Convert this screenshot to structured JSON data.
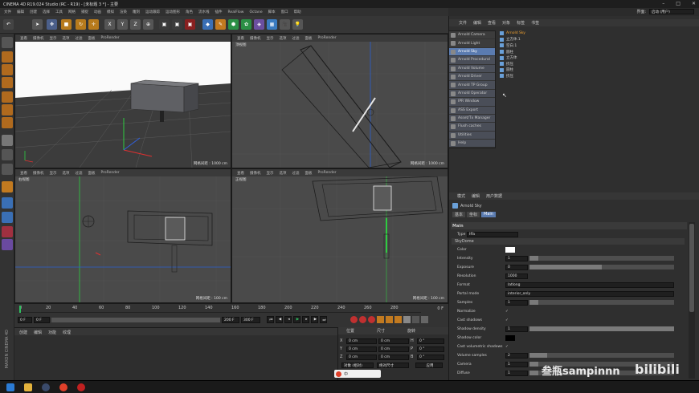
{
  "window": {
    "title": "CINEMA 4D R19.024 Studio (RC - R19) - [未标题 3 *] - 主要"
  },
  "menubar": [
    "文件",
    "编辑",
    "创建",
    "选择",
    "工具",
    "网格",
    "捕捉",
    "动画",
    "模拟",
    "渲染",
    "雕刻",
    "运动跟踪",
    "运动图形",
    "角色",
    "流水线",
    "插件",
    "RealFlow",
    "Octane",
    "脚本",
    "窗口",
    "帮助"
  ],
  "toolbar": {
    "x": "X",
    "y": "Y",
    "z": "Z"
  },
  "viewports": {
    "menu": [
      "查看",
      "摄像机",
      "显示",
      "选项",
      "过滤",
      "面板",
      "ProRender"
    ],
    "v1": {
      "label": "",
      "foot": "网格间距 : 1000 cm"
    },
    "v2": {
      "label": "顶视图",
      "foot": "网格间距 : 1000 cm"
    },
    "v3": {
      "label": "右视图",
      "foot": "网格间距 : 100 cm"
    },
    "v4": {
      "label": "正视图",
      "foot": "网格间距 : 100 cm"
    }
  },
  "timeline": {
    "ticks": [
      "0",
      "20",
      "40",
      "60",
      "80",
      "100",
      "120",
      "140",
      "160",
      "180",
      "200",
      "220",
      "240",
      "260",
      "280"
    ],
    "frame_start": "0 F",
    "frame_cur": "0 F",
    "frame_end": "200 F",
    "frame_end2": "300 F",
    "frame_label": "0 F"
  },
  "matpanel": {
    "menu": [
      "创建",
      "编辑",
      "功能",
      "纹理"
    ]
  },
  "coords": {
    "headers": [
      "位置",
      "尺寸",
      "旋转"
    ],
    "rows": [
      {
        "axis": "X",
        "pos": "0 cm",
        "size": "0 cm",
        "rot_axis": "H",
        "rot": "0 °"
      },
      {
        "axis": "Y",
        "pos": "0 cm",
        "size": "0 cm",
        "rot_axis": "P",
        "rot": "0 °"
      },
      {
        "axis": "Z",
        "pos": "0 cm",
        "size": "0 cm",
        "rot_axis": "B",
        "rot": "0 °"
      }
    ],
    "mode": "对象 (相对)",
    "size_mode": "绝对尺寸",
    "apply": "应用"
  },
  "right": {
    "layout_label": "界面:",
    "layout_value": "启动 (用户)",
    "obj_tabs": [
      "文件",
      "编辑",
      "查看",
      "对象",
      "标签",
      "书签"
    ],
    "dropdown": [
      "Arnold Camera",
      "Arnold Light",
      "Arnold Sky",
      "Arnold Procedural",
      "Arnold Volume",
      "Arnold Driver",
      "Arnold TP Group",
      "Arnold Operator",
      "IPR Window",
      "ASS Export",
      "Asset/Tx Manager",
      "Flush caches",
      "Utilities",
      "Help"
    ],
    "objects": [
      "Arnold Sky",
      "立方体.1",
      "空白.1",
      "圆柱",
      "立方体",
      "挤压",
      "圆柱",
      "挤压"
    ],
    "attr_tabs": [
      "模式",
      "编辑",
      "用户数据"
    ],
    "obj_name": "Arnold Sky",
    "sub_tabs": [
      "基本",
      "坐标",
      "Main"
    ],
    "section": "Main",
    "type_label": "Type",
    "type_value": "Iffa",
    "group": "SkyDome",
    "rows": [
      {
        "label": "Color",
        "value": "",
        "kind": "color"
      },
      {
        "label": "Intensity",
        "value": "1",
        "kind": "slider",
        "fill": 0.06
      },
      {
        "label": "Exposure",
        "value": "0",
        "kind": "slider",
        "fill": 0.5
      },
      {
        "label": "Resolution",
        "value": "1000",
        "kind": "field"
      },
      {
        "label": "Format",
        "value": "latlong",
        "kind": "select"
      },
      {
        "label": "Portal mode",
        "value": "interior_only",
        "kind": "select"
      },
      {
        "label": "Samples",
        "value": "1",
        "kind": "slider",
        "fill": 0.06
      },
      {
        "label": "Normalize",
        "value": "✓",
        "kind": "check"
      },
      {
        "label": "Cast shadows",
        "value": "✓",
        "kind": "check"
      },
      {
        "label": "Shadow density",
        "value": "1",
        "kind": "slider",
        "fill": 1.0
      },
      {
        "label": "Shadow color",
        "value": "",
        "kind": "black"
      },
      {
        "label": "Cast volumetric shadows",
        "value": "✓",
        "kind": "check"
      },
      {
        "label": "Volume samples",
        "value": "2",
        "kind": "slider",
        "fill": 0.12
      },
      {
        "label": "Camera",
        "value": "1",
        "kind": "slider",
        "fill": 0.06
      },
      {
        "label": "Diffuse",
        "value": "1",
        "kind": "slider",
        "fill": 0.06
      }
    ]
  },
  "watermark": "叁瓶sampinnn",
  "ime": "中",
  "brand": "MAXON CINEMA 4D"
}
